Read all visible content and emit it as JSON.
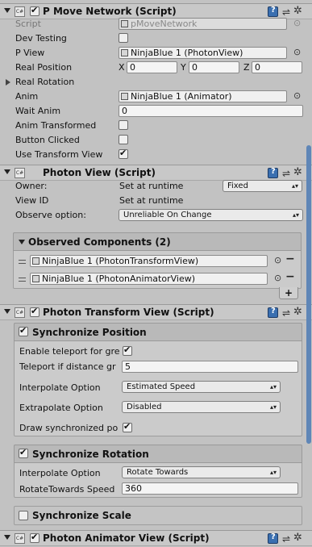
{
  "colors": {
    "background": "#c2c2c2",
    "header": "#c8c8c8",
    "scrollbar": "#5f86b7"
  },
  "pmove": {
    "title": "P Move Network (Script)",
    "script_label": "Script",
    "script_value": "pMoveNetwork",
    "dev_testing_label": "Dev Testing",
    "dev_testing": false,
    "pview_label": "P View",
    "pview_value": "NinjaBlue 1 (PhotonView)",
    "real_position_label": "Real Position",
    "x_label": "X",
    "x_value": "0",
    "y_label": "Y",
    "y_value": "0",
    "z_label": "Z",
    "z_value": "0",
    "real_rotation_label": "Real Rotation",
    "anim_label": "Anim",
    "anim_value": "NinjaBlue 1 (Animator)",
    "wait_anim_label": "Wait Anim",
    "wait_anim_value": "0",
    "anim_transformed_label": "Anim Transformed",
    "anim_transformed": false,
    "button_clicked_label": "Button Clicked",
    "button_clicked": false,
    "use_transform_view_label": "Use Transform View",
    "use_transform_view": true
  },
  "photon_view": {
    "title": "Photon View (Script)",
    "owner_label": "Owner:",
    "owner_value": "Set at runtime",
    "owner_dropdown": "Fixed",
    "view_id_label": "View ID",
    "view_id_value": "Set at runtime",
    "observe_label": "Observe option:",
    "observe_value": "Unreliable On Change",
    "observed_title": "Observed Components (2)",
    "observed": [
      {
        "label": "NinjaBlue 1 (PhotonTransformView)"
      },
      {
        "label": "NinjaBlue 1 (PhotonAnimatorView)"
      }
    ],
    "add_label": "+"
  },
  "transform_view": {
    "title": "Photon Transform View (Script)",
    "sync_position_title": "Synchronize Position",
    "enable_teleport_label": "Enable teleport for gre",
    "teleport_distance_label": "Teleport if distance gr",
    "teleport_distance_value": "5",
    "interpolate_label": "Interpolate Option",
    "interpolate_value": "Estimated Speed",
    "extrapolate_label": "Extrapolate Option",
    "extrapolate_value": "Disabled",
    "draw_sync_label": "Draw synchronized po",
    "sync_rotation_title": "Synchronize Rotation",
    "rot_interpolate_label": "Interpolate Option",
    "rot_interpolate_value": "Rotate Towards",
    "rot_speed_label": "RotateTowards Speed",
    "rot_speed_value": "360",
    "sync_scale_title": "Synchronize Scale"
  },
  "animator_view": {
    "title": "Photon Animator View (Script)"
  },
  "icons": [
    "fold-arrow-icon",
    "csharp-script-icon",
    "help-book-icon",
    "sliders-icon",
    "gear-icon",
    "object-target-icon",
    "drag-grip-icon",
    "minus-icon"
  ]
}
